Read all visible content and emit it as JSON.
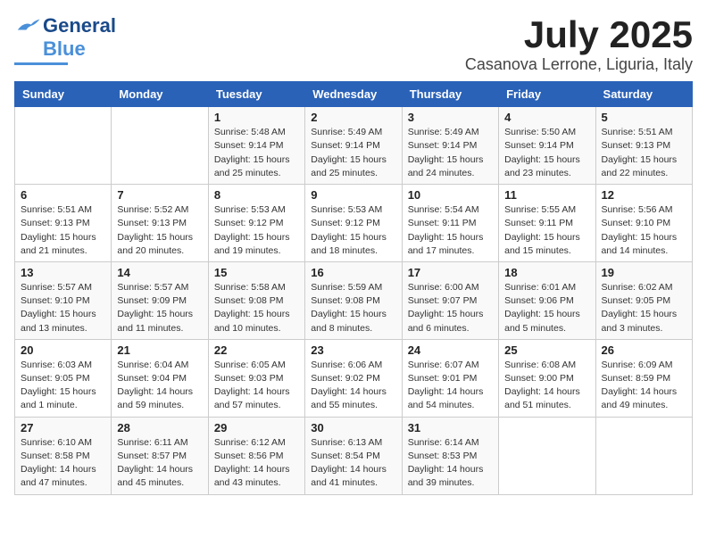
{
  "header": {
    "logo_general": "General",
    "logo_blue": "Blue",
    "month_title": "July 2025",
    "location": "Casanova Lerrone, Liguria, Italy"
  },
  "days_of_week": [
    "Sunday",
    "Monday",
    "Tuesday",
    "Wednesday",
    "Thursday",
    "Friday",
    "Saturday"
  ],
  "weeks": [
    [
      {
        "day": "",
        "info": ""
      },
      {
        "day": "",
        "info": ""
      },
      {
        "day": "1",
        "info": "Sunrise: 5:48 AM\nSunset: 9:14 PM\nDaylight: 15 hours\nand 25 minutes."
      },
      {
        "day": "2",
        "info": "Sunrise: 5:49 AM\nSunset: 9:14 PM\nDaylight: 15 hours\nand 25 minutes."
      },
      {
        "day": "3",
        "info": "Sunrise: 5:49 AM\nSunset: 9:14 PM\nDaylight: 15 hours\nand 24 minutes."
      },
      {
        "day": "4",
        "info": "Sunrise: 5:50 AM\nSunset: 9:14 PM\nDaylight: 15 hours\nand 23 minutes."
      },
      {
        "day": "5",
        "info": "Sunrise: 5:51 AM\nSunset: 9:13 PM\nDaylight: 15 hours\nand 22 minutes."
      }
    ],
    [
      {
        "day": "6",
        "info": "Sunrise: 5:51 AM\nSunset: 9:13 PM\nDaylight: 15 hours\nand 21 minutes."
      },
      {
        "day": "7",
        "info": "Sunrise: 5:52 AM\nSunset: 9:13 PM\nDaylight: 15 hours\nand 20 minutes."
      },
      {
        "day": "8",
        "info": "Sunrise: 5:53 AM\nSunset: 9:12 PM\nDaylight: 15 hours\nand 19 minutes."
      },
      {
        "day": "9",
        "info": "Sunrise: 5:53 AM\nSunset: 9:12 PM\nDaylight: 15 hours\nand 18 minutes."
      },
      {
        "day": "10",
        "info": "Sunrise: 5:54 AM\nSunset: 9:11 PM\nDaylight: 15 hours\nand 17 minutes."
      },
      {
        "day": "11",
        "info": "Sunrise: 5:55 AM\nSunset: 9:11 PM\nDaylight: 15 hours\nand 15 minutes."
      },
      {
        "day": "12",
        "info": "Sunrise: 5:56 AM\nSunset: 9:10 PM\nDaylight: 15 hours\nand 14 minutes."
      }
    ],
    [
      {
        "day": "13",
        "info": "Sunrise: 5:57 AM\nSunset: 9:10 PM\nDaylight: 15 hours\nand 13 minutes."
      },
      {
        "day": "14",
        "info": "Sunrise: 5:57 AM\nSunset: 9:09 PM\nDaylight: 15 hours\nand 11 minutes."
      },
      {
        "day": "15",
        "info": "Sunrise: 5:58 AM\nSunset: 9:08 PM\nDaylight: 15 hours\nand 10 minutes."
      },
      {
        "day": "16",
        "info": "Sunrise: 5:59 AM\nSunset: 9:08 PM\nDaylight: 15 hours\nand 8 minutes."
      },
      {
        "day": "17",
        "info": "Sunrise: 6:00 AM\nSunset: 9:07 PM\nDaylight: 15 hours\nand 6 minutes."
      },
      {
        "day": "18",
        "info": "Sunrise: 6:01 AM\nSunset: 9:06 PM\nDaylight: 15 hours\nand 5 minutes."
      },
      {
        "day": "19",
        "info": "Sunrise: 6:02 AM\nSunset: 9:05 PM\nDaylight: 15 hours\nand 3 minutes."
      }
    ],
    [
      {
        "day": "20",
        "info": "Sunrise: 6:03 AM\nSunset: 9:05 PM\nDaylight: 15 hours\nand 1 minute."
      },
      {
        "day": "21",
        "info": "Sunrise: 6:04 AM\nSunset: 9:04 PM\nDaylight: 14 hours\nand 59 minutes."
      },
      {
        "day": "22",
        "info": "Sunrise: 6:05 AM\nSunset: 9:03 PM\nDaylight: 14 hours\nand 57 minutes."
      },
      {
        "day": "23",
        "info": "Sunrise: 6:06 AM\nSunset: 9:02 PM\nDaylight: 14 hours\nand 55 minutes."
      },
      {
        "day": "24",
        "info": "Sunrise: 6:07 AM\nSunset: 9:01 PM\nDaylight: 14 hours\nand 54 minutes."
      },
      {
        "day": "25",
        "info": "Sunrise: 6:08 AM\nSunset: 9:00 PM\nDaylight: 14 hours\nand 51 minutes."
      },
      {
        "day": "26",
        "info": "Sunrise: 6:09 AM\nSunset: 8:59 PM\nDaylight: 14 hours\nand 49 minutes."
      }
    ],
    [
      {
        "day": "27",
        "info": "Sunrise: 6:10 AM\nSunset: 8:58 PM\nDaylight: 14 hours\nand 47 minutes."
      },
      {
        "day": "28",
        "info": "Sunrise: 6:11 AM\nSunset: 8:57 PM\nDaylight: 14 hours\nand 45 minutes."
      },
      {
        "day": "29",
        "info": "Sunrise: 6:12 AM\nSunset: 8:56 PM\nDaylight: 14 hours\nand 43 minutes."
      },
      {
        "day": "30",
        "info": "Sunrise: 6:13 AM\nSunset: 8:54 PM\nDaylight: 14 hours\nand 41 minutes."
      },
      {
        "day": "31",
        "info": "Sunrise: 6:14 AM\nSunset: 8:53 PM\nDaylight: 14 hours\nand 39 minutes."
      },
      {
        "day": "",
        "info": ""
      },
      {
        "day": "",
        "info": ""
      }
    ]
  ]
}
